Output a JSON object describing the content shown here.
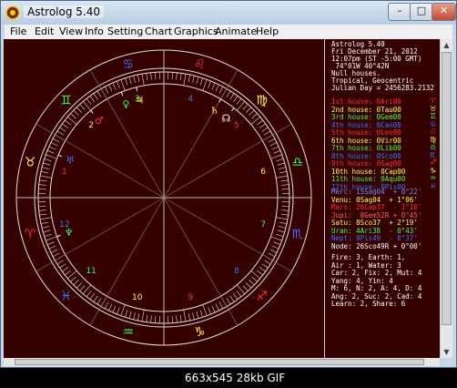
{
  "window": {
    "title": "Astrolog 5.40",
    "min_glyph": "–",
    "max_glyph": "□",
    "close_glyph": "✕"
  },
  "menu": [
    "File",
    "Edit",
    "View",
    "Info",
    "Setting",
    "Chart",
    "Graphics",
    "Animate",
    "Help"
  ],
  "chart_info": {
    "lines": [
      "Astrolog 5.40",
      "Fri December 21, 2012",
      "12:07pm (ST -5:00 GMT)",
      " 74°01W 40°42N",
      "Null houses.",
      "Tropical, Geocentric",
      "Julian Day = 2456283.2132"
    ]
  },
  "houses": [
    {
      "label": "1st house:",
      "value": "0Ari00",
      "color": "#ff3030",
      "glyph": "♈"
    },
    {
      "label": "2nd house:",
      "value": "0Tau00",
      "color": "#ffff40",
      "glyph": "♉"
    },
    {
      "label": "3rd house:",
      "value": "0Gem00",
      "color": "#40ff40",
      "glyph": "♊"
    },
    {
      "label": "4th house:",
      "value": "0Can00",
      "color": "#4070ff",
      "glyph": "♋"
    },
    {
      "label": "5th house:",
      "value": "0Leo00",
      "color": "#ff3030",
      "glyph": "♌"
    },
    {
      "label": "6th house:",
      "value": "0Vir00",
      "color": "#ffff40",
      "glyph": "♍"
    },
    {
      "label": "7th house:",
      "value": "0Lib00",
      "color": "#40ff40",
      "glyph": "♎"
    },
    {
      "label": "8th house:",
      "value": "0Sco00",
      "color": "#4070ff",
      "glyph": "♏"
    },
    {
      "label": "9th house:",
      "value": "0Sag00",
      "color": "#ff3030",
      "glyph": "♐"
    },
    {
      "label": "10th house:",
      "value": "0Cap00",
      "color": "#ffff40",
      "glyph": "♑"
    },
    {
      "label": "11th house:",
      "value": "0Aqu00",
      "color": "#40ff40",
      "glyph": "♒"
    },
    {
      "label": "12th house:",
      "value": "0Pis00",
      "color": "#4070ff",
      "glyph": "♓"
    }
  ],
  "planets": [
    {
      "name": "Merc:",
      "value": "15Sag04  + 0°22'",
      "color": "#7090ff"
    },
    {
      "name": "Venu:",
      "value": "0Sag04  + 1°06'",
      "color": "#ffff40"
    },
    {
      "name": "Mars:",
      "value": "26Cap37  - 1°10'",
      "color": "#ff3030"
    },
    {
      "name": "Jupi:",
      "value": " 8Gem52R + 0°45'",
      "color": "#ff6060"
    },
    {
      "name": "Satu:",
      "value": "8Sco37  + 2°19'",
      "color": "#ffff40"
    },
    {
      "name": "Uran:",
      "value": "4Ari38  - 0°43'",
      "color": "#40ff40"
    },
    {
      "name": "Nept:",
      "value": "0Pis49  - 0°37'",
      "color": "#4070ff"
    },
    {
      "name": "Node:",
      "value": "26Sco49R + 0°00'",
      "color": "#ffffff"
    }
  ],
  "stats": [
    "Fire: 3, Earth: 1,",
    "Air : 1, Water: 3",
    "Car: 2, Fix: 2, Mut: 4",
    "Yang: 4, Yin: 4",
    "M: 6, N: 2, A: 4, D: 4",
    "Ang: 2, Suc: 2, Cad: 4",
    "Learn: 2, Share: 6"
  ],
  "wheel": {
    "house_numbers": [
      "1",
      "2",
      "3",
      "4",
      "5",
      "6",
      "7",
      "8",
      "9",
      "10",
      "11",
      "12"
    ],
    "signs": [
      "♈",
      "♉",
      "♊",
      "♋",
      "♌",
      "♍",
      "♎",
      "♏",
      "♐",
      "♑",
      "♒",
      "♓"
    ],
    "sign_colors": [
      "#ff3030",
      "#ffff40",
      "#40ff40",
      "#4070ff",
      "#ff3030",
      "#ffff40",
      "#40ff40",
      "#4070ff",
      "#ff3030",
      "#ffff40",
      "#40ff40",
      "#4070ff"
    ],
    "planet_glyphs": [
      {
        "glyph": "♀",
        "color": "#40ff40"
      },
      {
        "glyph": "♃",
        "color": "#ffff40"
      },
      {
        "glyph": "♄",
        "color": "#ffff40"
      },
      {
        "glyph": "♂",
        "color": "#ff3030"
      },
      {
        "glyph": "♅",
        "color": "#4070ff"
      },
      {
        "glyph": "♆",
        "color": "#40ff40"
      },
      {
        "glyph": "☊",
        "color": "#ffffff"
      }
    ]
  },
  "status": "663x545  28kb  GIF"
}
